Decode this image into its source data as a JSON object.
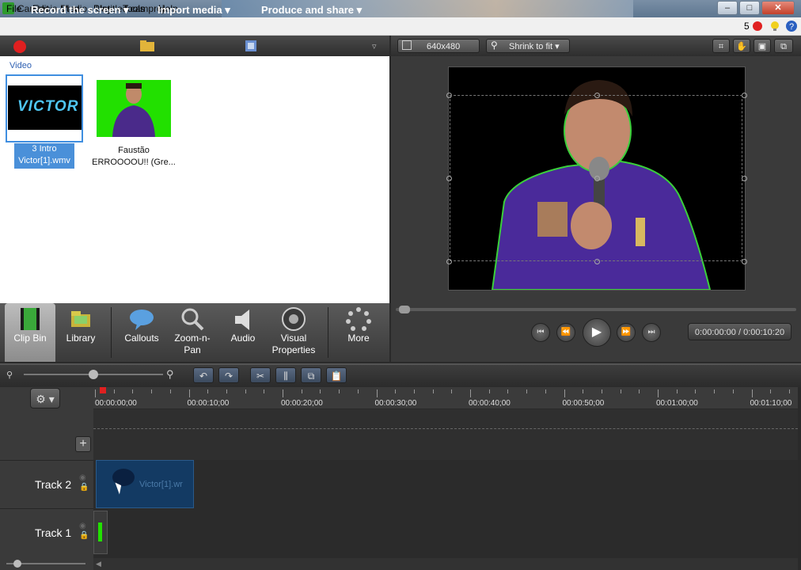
{
  "window": {
    "title": "Camtasia Studio - Untitled.camproj",
    "min": "–",
    "max": "□",
    "close": "✕"
  },
  "menu": {
    "items": [
      "File",
      "Edit",
      "View",
      "Play",
      "Tools",
      "Help"
    ],
    "notification_count": "5"
  },
  "toolbar": {
    "record": "Record the screen",
    "import": "Import media",
    "produce": "Produce and share"
  },
  "clipbin": {
    "section": "Video",
    "clips": [
      {
        "thumb_text": "VICTOR",
        "label": "3 Intro Victor[1].wmv"
      },
      {
        "label": "Faustão ERROOOOU!! (Gre..."
      }
    ]
  },
  "tabs": [
    {
      "label": "Clip Bin"
    },
    {
      "label": "Library"
    },
    {
      "label": "Callouts"
    },
    {
      "label": "Zoom-n-Pan"
    },
    {
      "label": "Audio"
    },
    {
      "label": "Visual Properties"
    },
    {
      "label": "More"
    }
  ],
  "preview": {
    "dimensions": "640x480",
    "zoom": "Shrink to fit",
    "time": "0:00:00:00 / 0:00:10:20"
  },
  "timeline": {
    "ticks": [
      "00:00:00;00",
      "00:00:10;00",
      "00:00:20;00",
      "00:00:30;00",
      "00:00:40;00",
      "00:00:50;00",
      "00:01:00;00",
      "00:01:10;00"
    ],
    "tracks": [
      "Track 2",
      "Track 1"
    ],
    "clip_label": "Victor[1].wr"
  },
  "colors": {
    "accent": "#3f8ee0",
    "green_screen": "#22e000",
    "record_red": "#e02020"
  }
}
